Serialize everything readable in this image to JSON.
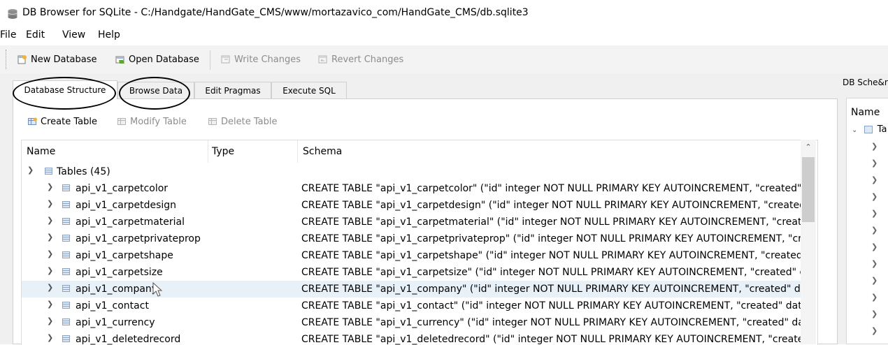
{
  "window": {
    "title": "DB Browser for SQLite - C:/Handgate/HandGate_CMS/www/mortazavico_com/HandGate_CMS/db.sqlite3"
  },
  "menu": [
    "File",
    "Edit",
    "View",
    "Help"
  ],
  "toolbar": {
    "new_database": "New Database",
    "open_database": "Open Database",
    "write_changes": "Write Changes",
    "revert_changes": "Revert Changes"
  },
  "tabs": [
    "Database Structure",
    "Browse Data",
    "Edit Pragmas",
    "Execute SQL"
  ],
  "active_tab": "Database Structure",
  "structure_toolbar": {
    "create_table": "Create Table",
    "modify_table": "Modify Table",
    "delete_table": "Delete Table"
  },
  "tree": {
    "columns": [
      "Name",
      "Type",
      "Schema"
    ],
    "tables_label": "Tables (45)",
    "rows": [
      {
        "name": "api_v1_carpetcolor",
        "type": "",
        "schema": "CREATE TABLE \"api_v1_carpetcolor\" (\"id\" integer NOT NULL PRIMARY KEY AUTOINCREMENT, \"created\" d"
      },
      {
        "name": "api_v1_carpetdesign",
        "type": "",
        "schema": "CREATE TABLE \"api_v1_carpetdesign\" (\"id\" integer NOT NULL PRIMARY KEY AUTOINCREMENT, \"created\""
      },
      {
        "name": "api_v1_carpetmaterial",
        "type": "",
        "schema": "CREATE TABLE \"api_v1_carpetmaterial\" (\"id\" integer NOT NULL PRIMARY KEY AUTOINCREMENT, \"created"
      },
      {
        "name": "api_v1_carpetprivateprop",
        "type": "",
        "schema": "CREATE TABLE \"api_v1_carpetprivateprop\" (\"id\" integer NOT NULL PRIMARY KEY AUTOINCREMENT, \"cre"
      },
      {
        "name": "api_v1_carpetshape",
        "type": "",
        "schema": "CREATE TABLE \"api_v1_carpetshape\" (\"id\" integer NOT NULL PRIMARY KEY AUTOINCREMENT, \"created\""
      },
      {
        "name": "api_v1_carpetsize",
        "type": "",
        "schema": "CREATE TABLE \"api_v1_carpetsize\" (\"id\" integer NOT NULL PRIMARY KEY AUTOINCREMENT, \"created\" da"
      },
      {
        "name": "api_v1_company",
        "type": "",
        "schema": "CREATE TABLE \"api_v1_company\" (\"id\" integer NOT NULL PRIMARY KEY AUTOINCREMENT, \"created\" da"
      },
      {
        "name": "api_v1_contact",
        "type": "",
        "schema": "CREATE TABLE \"api_v1_contact\" (\"id\" integer NOT NULL PRIMARY KEY AUTOINCREMENT, \"created\" date"
      },
      {
        "name": "api_v1_currency",
        "type": "",
        "schema": "CREATE TABLE \"api_v1_currency\" (\"id\" integer NOT NULL PRIMARY KEY AUTOINCREMENT, \"created\" dat"
      },
      {
        "name": "api_v1_deletedrecord",
        "type": "",
        "schema": "CREATE TABLE \"api_v1_deletedrecord\" (\"id\" integer NOT NULL PRIMARY KEY AUTOINCREMENT, \"createc"
      }
    ]
  },
  "right_dock": {
    "title": "DB Sche&r",
    "name_header": "Name",
    "tables_abbrev": "Ta"
  },
  "colors": {
    "toolbar_bg": "#f3f3f3",
    "selected_row": "#e8f0f8",
    "disabled_text": "#8c8c8c"
  }
}
